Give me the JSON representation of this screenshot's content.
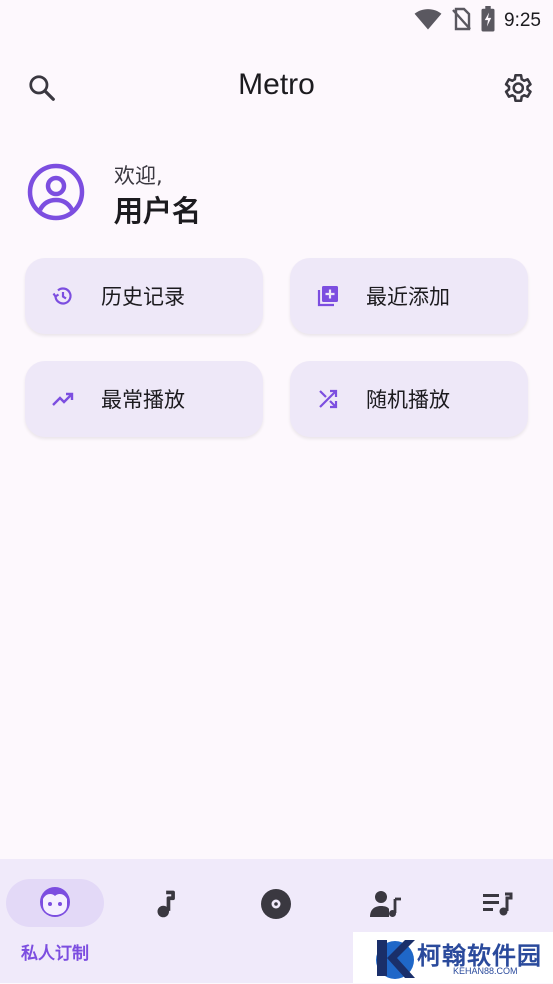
{
  "status_bar": {
    "time": "9:25",
    "icons": [
      "wifi-icon",
      "no-sim-icon",
      "battery-charging-icon"
    ]
  },
  "top_bar": {
    "title": "Metro",
    "left_icon": "search-icon",
    "right_icon": "settings-icon"
  },
  "profile": {
    "welcome": "欢迎,",
    "user_name": "用户名",
    "icon": "account-circle-icon"
  },
  "shortcuts": [
    {
      "label": "历史记录",
      "icon": "history-icon"
    },
    {
      "label": "最近添加",
      "icon": "library-add-icon"
    },
    {
      "label": "最常播放",
      "icon": "trending-up-icon"
    },
    {
      "label": "随机播放",
      "icon": "shuffle-icon"
    }
  ],
  "bottom_nav": {
    "items": [
      {
        "label": "私人订制",
        "icon": "face-icon",
        "selected": true
      },
      {
        "label": "",
        "icon": "music-note-icon",
        "selected": false
      },
      {
        "label": "",
        "icon": "album-icon",
        "selected": false
      },
      {
        "label": "",
        "icon": "artist-icon",
        "selected": false
      },
      {
        "label": "",
        "icon": "playlist-icon",
        "selected": false
      }
    ]
  },
  "watermark": {
    "text": "柯翰软件园",
    "subtext": "KEHAN88.COM"
  },
  "colors": {
    "background": "#fdf8fd",
    "accent": "#7c4ee0",
    "card": "#eee8f8",
    "nav_background": "#f0eafa",
    "nav_indicator": "#e3d9f7",
    "icon_dark": "#3a3840"
  }
}
